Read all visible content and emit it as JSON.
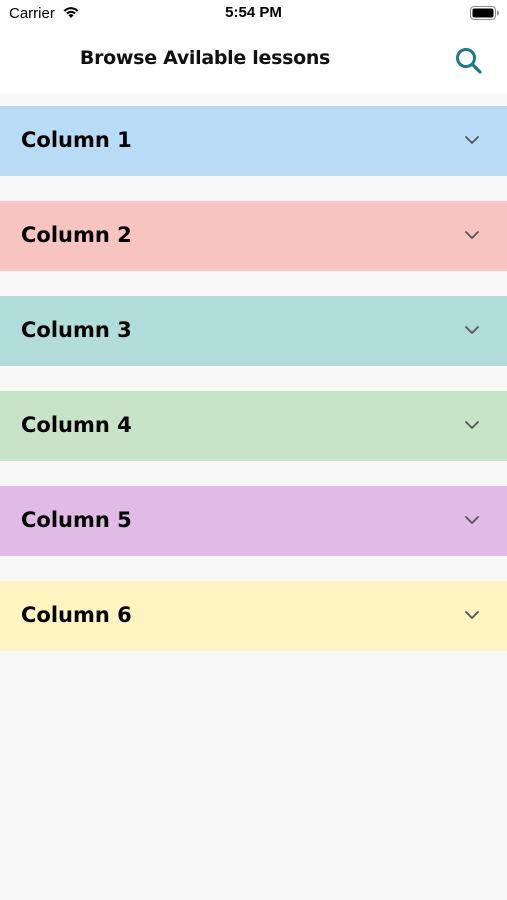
{
  "status_bar": {
    "carrier": "Carrier",
    "time": "5:54 PM",
    "wifi_icon": "wifi-icon",
    "battery_icon": "battery-icon"
  },
  "nav": {
    "title": "Browse Avilable lessons",
    "search_icon": "search-icon",
    "accent_color": "#1a7a8a"
  },
  "columns": [
    {
      "label": "Column 1",
      "color": "#b8dcf6"
    },
    {
      "label": "Column 2",
      "color": "#f8c4c0"
    },
    {
      "label": "Column 3",
      "color": "#b0ddd9"
    },
    {
      "label": "Column 4",
      "color": "#c7e4c8"
    },
    {
      "label": "Column 5",
      "color": "#dfbbe5"
    },
    {
      "label": "Column 6",
      "color": "#fdf4c0"
    }
  ],
  "chevron_icon": "chevron-down-icon"
}
